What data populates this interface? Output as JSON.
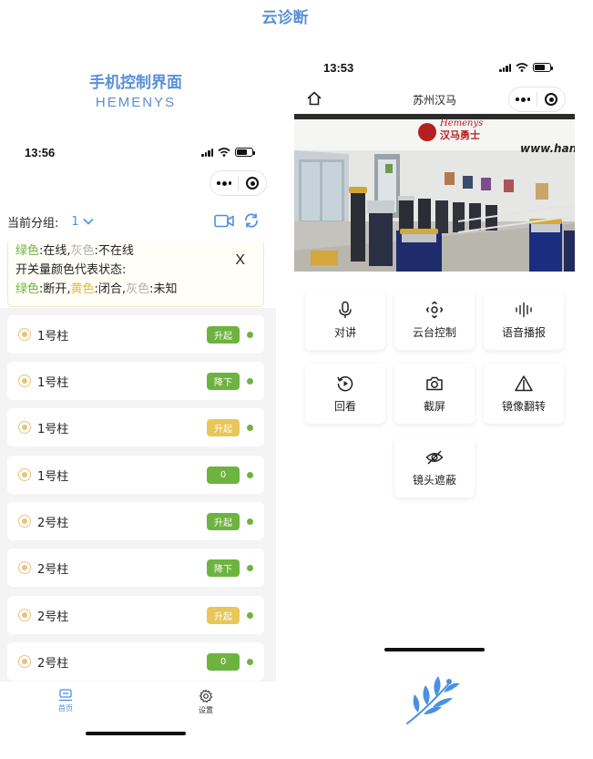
{
  "page_title": "云诊断",
  "left": {
    "header_title": "手机控制界面",
    "header_sub": "HEMENYS",
    "status_time": "13:56",
    "group_label": "当前分组:",
    "group_value": "1",
    "legend": {
      "l1_green": "绿色",
      "l1_a": ":在线,",
      "l1_gray": "灰色",
      "l1_b": ":不在线",
      "l2": "开关量颜色代表状态:",
      "l3_green": "绿色",
      "l3_a": ":断开,",
      "l3_yellow": "黄色",
      "l3_b": ":闭合,",
      "l3_gray": "灰色",
      "l3_c": ":未知",
      "close": "X"
    },
    "items": [
      {
        "name": "1号柱",
        "badge": "升起",
        "badge_color": "#6db33f"
      },
      {
        "name": "1号柱",
        "badge": "降下",
        "badge_color": "#6db33f"
      },
      {
        "name": "1号柱",
        "badge": "升起",
        "badge_color": "#e8c65a"
      },
      {
        "name": "1号柱",
        "badge": "0",
        "badge_color": "#6db33f"
      },
      {
        "name": "2号柱",
        "badge": "升起",
        "badge_color": "#6db33f"
      },
      {
        "name": "2号柱",
        "badge": "降下",
        "badge_color": "#6db33f"
      },
      {
        "name": "2号柱",
        "badge": "升起",
        "badge_color": "#e8c65a"
      },
      {
        "name": "2号柱",
        "badge": "0",
        "badge_color": "#6db33f"
      }
    ],
    "tabs": [
      {
        "label": "首页",
        "icon": "home-icon",
        "color": "#4a90e2"
      },
      {
        "label": "设置",
        "icon": "gear-icon",
        "color": "#333333"
      }
    ]
  },
  "right": {
    "status_time": "13:53",
    "nav_title": "苏州汉马",
    "photo_brand": "Hemenys",
    "photo_brand_cn": "汉马勇士",
    "photo_url_text": "www.han",
    "buttons": [
      {
        "label": "对讲",
        "icon": "microphone-icon"
      },
      {
        "label": "云台控制",
        "icon": "ptz-control-icon"
      },
      {
        "label": "语音播报",
        "icon": "voice-wave-icon"
      },
      {
        "label": "回看",
        "icon": "playback-icon"
      },
      {
        "label": "截屏",
        "icon": "camera-icon"
      },
      {
        "label": "镜像翻转",
        "icon": "mirror-flip-icon"
      },
      {
        "label": "镜头遮蔽",
        "icon": "eye-off-icon"
      }
    ]
  },
  "colors": {
    "accent": "#5b8fd6",
    "green": "#6db33f",
    "yellow": "#e8c65a",
    "link": "#4a90e2"
  }
}
